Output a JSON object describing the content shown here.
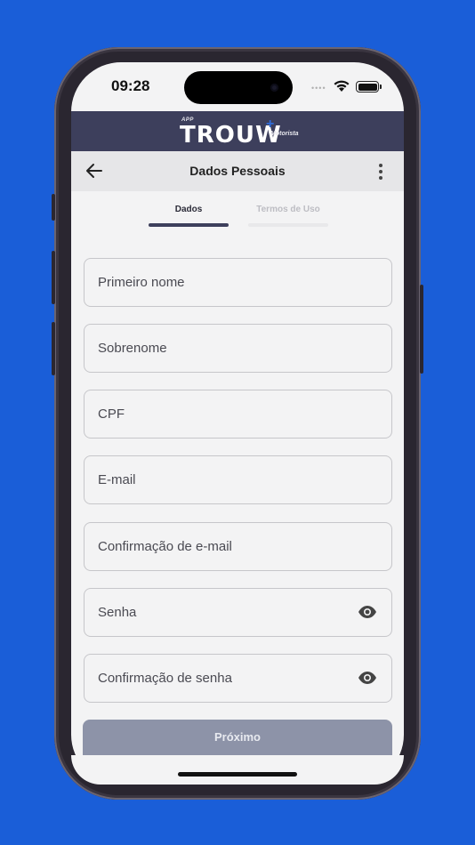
{
  "status_bar": {
    "time": "09:28",
    "signal": "••••"
  },
  "brand": {
    "app_label": "APP",
    "logo_word": "TROUW",
    "logo_sub": "Motorista",
    "plus": "+"
  },
  "header": {
    "title": "Dados Pessoais"
  },
  "tabs": [
    {
      "label": "Dados",
      "active": true
    },
    {
      "label": "Termos de Uso",
      "active": false
    }
  ],
  "form": {
    "first_name": {
      "placeholder": "Primeiro nome",
      "value": ""
    },
    "last_name": {
      "placeholder": "Sobrenome",
      "value": ""
    },
    "cpf": {
      "placeholder": "CPF",
      "value": ""
    },
    "email": {
      "placeholder": "E-mail",
      "value": ""
    },
    "email_confirm": {
      "placeholder": "Confirmação de e-mail",
      "value": ""
    },
    "password": {
      "placeholder": "Senha",
      "value": ""
    },
    "password_confirm": {
      "placeholder": "Confirmação de senha",
      "value": ""
    }
  },
  "next_button": {
    "label": "Próximo"
  },
  "colors": {
    "background": "#1a5ed8",
    "brand_bar": "#3d3f5c",
    "button_disabled": "#8d93a8"
  }
}
